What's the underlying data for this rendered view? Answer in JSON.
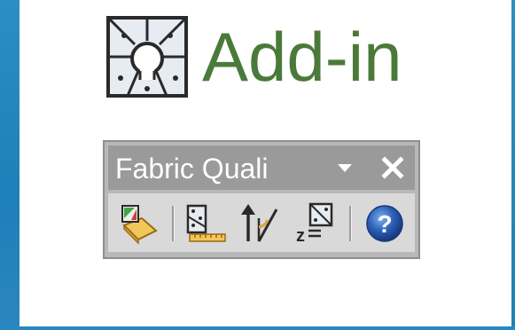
{
  "header": {
    "title": "Add-in",
    "logo_icon": "fabric-parcel-logo-icon",
    "title_color": "#4a7a3a"
  },
  "toolbar": {
    "title": "Fabric Quali",
    "dropdown_icon": "chevron-down-icon",
    "close_icon": "close-icon",
    "buttons": [
      {
        "icon": "fabric-load-icon"
      },
      {
        "icon": "parcel-measure-icon"
      },
      {
        "icon": "direction-angle-icon"
      },
      {
        "icon": "elevation-z-icon"
      },
      {
        "icon": "help-icon"
      }
    ]
  },
  "colors": {
    "desktop_blue": "#1f7fb8",
    "toolbar_frame": "#b8b8b8",
    "titlebar": "#9a9a9a",
    "help_blue": "#2b5fb8"
  }
}
